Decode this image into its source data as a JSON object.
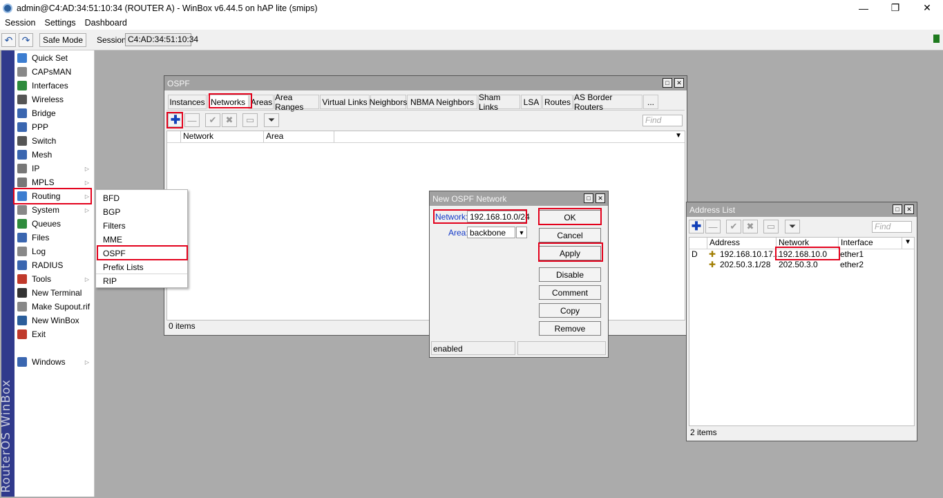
{
  "window": {
    "title": "admin@C4:AD:34:51:10:34 (ROUTER A) - WinBox v6.44.5 on hAP lite (smips)",
    "min": "—",
    "max": "❐",
    "close": "✕"
  },
  "menubar": [
    "Session",
    "Settings",
    "Dashboard"
  ],
  "toolbar": {
    "undo": "↶",
    "redo": "↷",
    "safe_mode": "Safe Mode",
    "session_label": "Session:",
    "session_value": "C4:AD:34:51:10:34"
  },
  "brand": "RouterOS WinBox",
  "sidebar": {
    "items": [
      {
        "label": "Quick Set",
        "icon": "quick-set-icon",
        "color": "#3c7dd0",
        "arrow": ""
      },
      {
        "label": "CAPsMAN",
        "icon": "capsman-icon",
        "color": "#888888",
        "arrow": ""
      },
      {
        "label": "Interfaces",
        "icon": "interfaces-icon",
        "color": "#2e8b3c",
        "arrow": ""
      },
      {
        "label": "Wireless",
        "icon": "wireless-icon",
        "color": "#555555",
        "arrow": ""
      },
      {
        "label": "Bridge",
        "icon": "bridge-icon",
        "color": "#3a66b0",
        "arrow": ""
      },
      {
        "label": "PPP",
        "icon": "ppp-icon",
        "color": "#3a66b0",
        "arrow": ""
      },
      {
        "label": "Switch",
        "icon": "switch-icon",
        "color": "#555555",
        "arrow": ""
      },
      {
        "label": "Mesh",
        "icon": "mesh-icon",
        "color": "#3a66b0",
        "arrow": ""
      },
      {
        "label": "IP",
        "icon": "ip-icon",
        "color": "#777777",
        "arrow": "▷"
      },
      {
        "label": "MPLS",
        "icon": "mpls-icon",
        "color": "#777777",
        "arrow": "▷"
      },
      {
        "label": "Routing",
        "icon": "routing-icon",
        "color": "#3c7dd0",
        "arrow": "▷"
      },
      {
        "label": "System",
        "icon": "system-icon",
        "color": "#888888",
        "arrow": "▷"
      },
      {
        "label": "Queues",
        "icon": "queues-icon",
        "color": "#2e8b3c",
        "arrow": ""
      },
      {
        "label": "Files",
        "icon": "files-icon",
        "color": "#3a66b0",
        "arrow": ""
      },
      {
        "label": "Log",
        "icon": "log-icon",
        "color": "#888888",
        "arrow": ""
      },
      {
        "label": "RADIUS",
        "icon": "radius-icon",
        "color": "#3a66b0",
        "arrow": ""
      },
      {
        "label": "Tools",
        "icon": "tools-icon",
        "color": "#c0392b",
        "arrow": "▷"
      },
      {
        "label": "New Terminal",
        "icon": "terminal-icon",
        "color": "#333333",
        "arrow": ""
      },
      {
        "label": "Make Supout.rif",
        "icon": "supout-icon",
        "color": "#888888",
        "arrow": ""
      },
      {
        "label": "New WinBox",
        "icon": "winbox-icon",
        "color": "#2b5e9b",
        "arrow": ""
      },
      {
        "label": "Exit",
        "icon": "exit-icon",
        "color": "#c0392b",
        "arrow": ""
      },
      {
        "label": "Windows",
        "icon": "windows-icon",
        "color": "#3a66b0",
        "arrow": "▷"
      }
    ]
  },
  "routing_submenu": [
    "BFD",
    "BGP",
    "Filters",
    "MME",
    "OSPF",
    "Prefix Lists",
    "RIP"
  ],
  "ospf": {
    "title": "OSPF",
    "tabs": [
      "Instances",
      "Networks",
      "Areas",
      "Area Ranges",
      "Virtual Links",
      "Neighbors",
      "NBMA Neighbors",
      "Sham Links",
      "LSA",
      "Routes",
      "AS Border Routers",
      "..."
    ],
    "find_placeholder": "Find",
    "columns": [
      "Network",
      "Area"
    ],
    "status": "0 items"
  },
  "dialog": {
    "title": "New OSPF Network",
    "network_label": "Network:",
    "network_value": "192.168.10.0/24",
    "area_label": "Area:",
    "area_value": "backbone",
    "buttons": [
      "OK",
      "Cancel",
      "Apply",
      "Disable",
      "Comment",
      "Copy",
      "Remove"
    ],
    "status": "enabled"
  },
  "address_list": {
    "title": "Address List",
    "find_placeholder": "Find",
    "columns": [
      "Address",
      "Network",
      "Interface"
    ],
    "rows": [
      {
        "flag": "D",
        "address": "192.168.10.17...",
        "network": "192.168.10.0",
        "interface": "ether1"
      },
      {
        "flag": "",
        "address": "202.50.3.1/28",
        "network": "202.50.3.0",
        "interface": "ether2"
      }
    ],
    "status": "2 items"
  }
}
